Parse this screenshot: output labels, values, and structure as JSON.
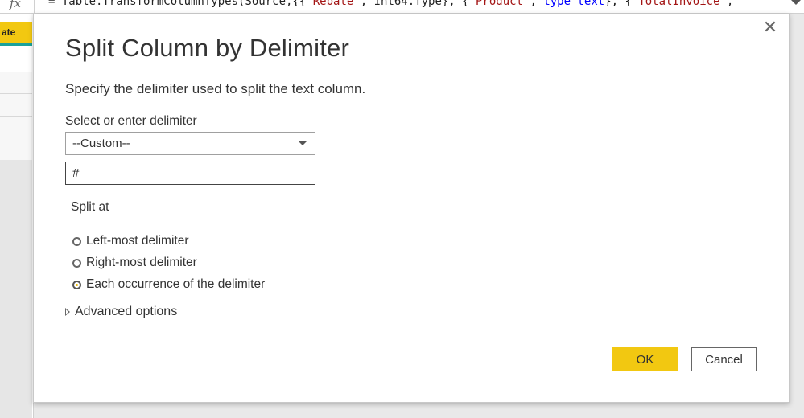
{
  "formula_bar": {
    "fx_label": "fx",
    "parts": [
      {
        "text": "= Table.TransformColumnTypes(Source,{{",
        "cls": ""
      },
      {
        "text": "\"Rebate\"",
        "cls": "str"
      },
      {
        "text": ", Int64.Type}, {",
        "cls": ""
      },
      {
        "text": "\"Product\"",
        "cls": "str"
      },
      {
        "text": ", ",
        "cls": ""
      },
      {
        "text": "type",
        "cls": "kw"
      },
      {
        "text": " ",
        "cls": ""
      },
      {
        "text": "text",
        "cls": "kw"
      },
      {
        "text": "}, {",
        "cls": ""
      },
      {
        "text": "\"TotalInvoice\"",
        "cls": "str"
      },
      {
        "text": ",",
        "cls": ""
      }
    ]
  },
  "grid": {
    "column_header": "ate"
  },
  "dialog": {
    "title": "Split Column by Delimiter",
    "description": "Specify the delimiter used to split the text column.",
    "delimiter_label": "Select or enter delimiter",
    "delimiter_selected": "--Custom--",
    "custom_delimiter_value": "#",
    "split_at_label": "Split at",
    "split_options": [
      {
        "label": "Left-most delimiter",
        "checked": false
      },
      {
        "label": "Right-most delimiter",
        "checked": false
      },
      {
        "label": "Each occurrence of the delimiter",
        "checked": true
      }
    ],
    "advanced_options_label": "Advanced options",
    "ok_label": "OK",
    "cancel_label": "Cancel",
    "close_glyph": "✕"
  },
  "colors": {
    "accent": "#f2c811",
    "teal": "#1aa19a"
  }
}
